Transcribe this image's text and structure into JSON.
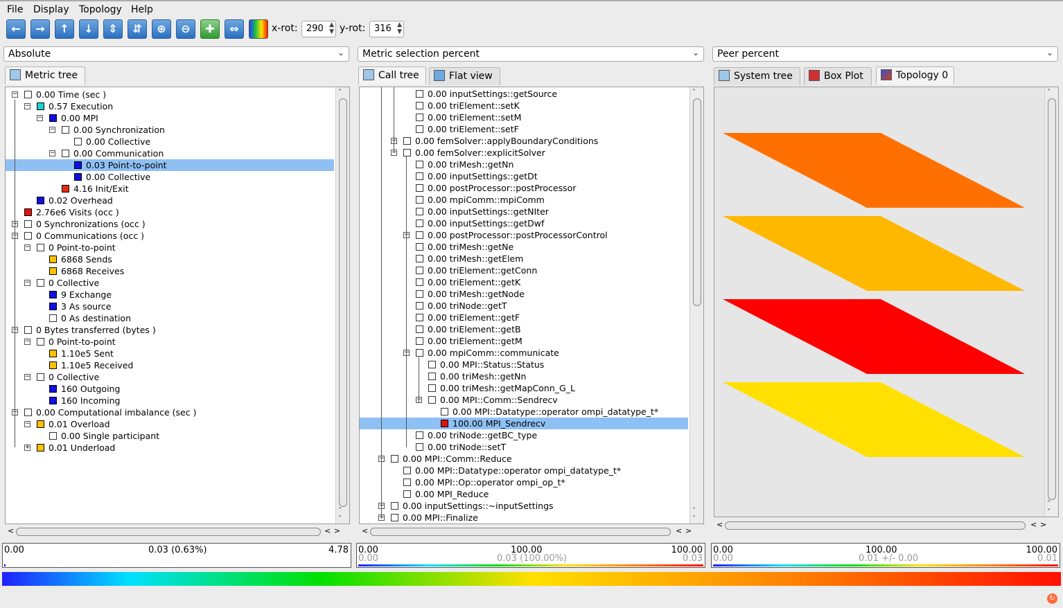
{
  "menu": {
    "file": "File",
    "display": "Display",
    "topology": "Topology",
    "help": "Help"
  },
  "toolbar": {
    "xrot_label": "x-rot:",
    "xrot_value": "290",
    "yrot_label": "y-rot:",
    "yrot_value": "316",
    "buttons": [
      "arrow-left-icon",
      "arrow-right-icon",
      "arrow-up-icon",
      "arrow-down-icon",
      "expand-vertical-icon",
      "collapse-vertical-icon",
      "zoom-in-icon",
      "zoom-out-icon",
      "center-icon",
      "expand-horizontal-icon",
      "color-icon"
    ]
  },
  "panels": {
    "left": {
      "mode": "Absolute",
      "tab": "Metric tree"
    },
    "middle": {
      "mode": "Metric selection percent",
      "tabs": [
        "Call tree",
        "Flat view"
      ]
    },
    "right": {
      "mode": "Peer percent",
      "tabs": [
        "System tree",
        "Box Plot",
        "Topology 0"
      ]
    }
  },
  "metric_tree": [
    {
      "label": "0.00 Time (sec )"
    },
    {
      "label": "0.57 Execution"
    },
    {
      "label": "0.00 MPI"
    },
    {
      "label": "0.00 Synchronization"
    },
    {
      "label": "0.00 Collective"
    },
    {
      "label": "0.00 Communication"
    },
    {
      "label": "0.03 Point-to-point"
    },
    {
      "label": "0.00 Collective"
    },
    {
      "label": "4.16 Init/Exit"
    },
    {
      "label": "0.02 Overhead"
    },
    {
      "label": "2.76e6 Visits (occ )"
    },
    {
      "label": "0 Synchronizations (occ )"
    },
    {
      "label": "0 Communications (occ )"
    },
    {
      "label": "0 Point-to-point"
    },
    {
      "label": "6868 Sends"
    },
    {
      "label": "6868 Receives"
    },
    {
      "label": "0 Collective"
    },
    {
      "label": "9 Exchange"
    },
    {
      "label": "3 As source"
    },
    {
      "label": "0 As destination"
    },
    {
      "label": "0 Bytes transferred (bytes )"
    },
    {
      "label": "0 Point-to-point"
    },
    {
      "label": "1.10e5 Sent"
    },
    {
      "label": "1.10e5 Received"
    },
    {
      "label": "0 Collective"
    },
    {
      "label": "160 Outgoing"
    },
    {
      "label": "160 Incoming"
    },
    {
      "label": "0.00 Computational imbalance (sec )"
    },
    {
      "label": "0.01 Overload"
    },
    {
      "label": "0.00 Single participant"
    },
    {
      "label": "0.01 Underload"
    }
  ],
  "call_tree": [
    {
      "label": "0.00 inputSettings::getSource"
    },
    {
      "label": "0.00 triElement::setK"
    },
    {
      "label": "0.00 triElement::setM"
    },
    {
      "label": "0.00 triElement::setF"
    },
    {
      "label": "0.00 femSolver::applyBoundaryConditions"
    },
    {
      "label": "0.00 femSolver::explicitSolver"
    },
    {
      "label": "0.00 triMesh::getNn"
    },
    {
      "label": "0.00 inputSettings::getDt"
    },
    {
      "label": "0.00 postProcessor::postProcessor"
    },
    {
      "label": "0.00 mpiComm::mpiComm"
    },
    {
      "label": "0.00 inputSettings::getNIter"
    },
    {
      "label": "0.00 inputSettings::getDwf"
    },
    {
      "label": "0.00 postProcessor::postProcessorControl"
    },
    {
      "label": "0.00 triMesh::getNe"
    },
    {
      "label": "0.00 triMesh::getElem"
    },
    {
      "label": "0.00 triElement::getConn"
    },
    {
      "label": "0.00 triElement::getK"
    },
    {
      "label": "0.00 triMesh::getNode"
    },
    {
      "label": "0.00 triNode::getT"
    },
    {
      "label": "0.00 triElement::getF"
    },
    {
      "label": "0.00 triElement::getB"
    },
    {
      "label": "0.00 triElement::getM"
    },
    {
      "label": "0.00 mpiComm::communicate"
    },
    {
      "label": "0.00 MPI::Status::Status"
    },
    {
      "label": "0.00 triMesh::getNn"
    },
    {
      "label": "0.00 triMesh::getMapConn_G_L"
    },
    {
      "label": "0.00 MPI::Comm::Sendrecv"
    },
    {
      "label": "0.00 MPI::Datatype::operator ompi_datatype_t*"
    },
    {
      "label": "100.00 MPI_Sendrecv"
    },
    {
      "label": "0.00 triNode::getBC_type"
    },
    {
      "label": "0.00 triNode::setT"
    },
    {
      "label": "0.00 MPI::Comm::Reduce"
    },
    {
      "label": "0.00 MPI::Datatype::operator ompi_datatype_t*"
    },
    {
      "label": "0.00 MPI::Op::operator ompi_op_t*"
    },
    {
      "label": "0.00 MPI_Reduce"
    },
    {
      "label": "0.00 inputSettings::~inputSettings"
    },
    {
      "label": "0.00 MPI::Finalize"
    }
  ],
  "topology_planes": [
    {
      "color": "#ff7000"
    },
    {
      "color": "#ffb800"
    },
    {
      "color": "#ff0000"
    },
    {
      "color": "#ffe000"
    }
  ],
  "valuebars": {
    "left": {
      "min": "0.00",
      "mid": "0.03 (0.63%)",
      "max": "4.78"
    },
    "middle": {
      "min": "0.00",
      "mid": "100.00",
      "max": "100.00",
      "min2": "0.00",
      "mid2": "0.03 (100.00%)",
      "max2": "0.03"
    },
    "right": {
      "min": "0.00",
      "mid": "100.00",
      "max": "100.00",
      "min2": "0.00",
      "mid2": "0.01 +/- 0.00",
      "max2": "0.01"
    }
  },
  "colors": {
    "selection": "#8fc0f3",
    "gradient": [
      "#2020ff",
      "#00e0ff",
      "#00e000",
      "#ffe000",
      "#ff8000",
      "#ff1000"
    ]
  }
}
